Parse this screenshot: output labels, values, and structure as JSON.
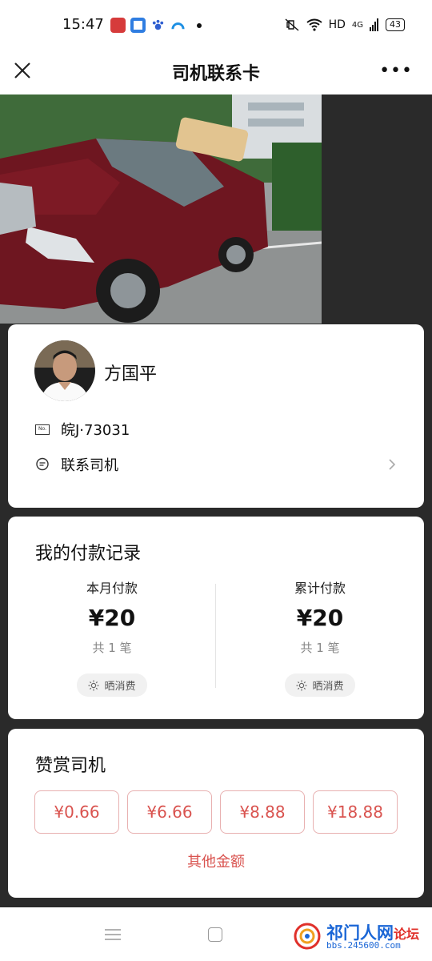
{
  "status_bar": {
    "time": "15:47",
    "network": "HD",
    "signal": "4G",
    "battery": "43",
    "app_icons": [
      "red-app-icon",
      "blue-circle-app-icon",
      "paw-app-icon",
      "arc-app-icon"
    ],
    "indicators": [
      "mute-icon",
      "wifi-icon",
      "signal-icon"
    ]
  },
  "nav": {
    "title": "司机联系卡",
    "close_icon": "close-icon",
    "more_icon": "more-icon",
    "more_label": "•••"
  },
  "driver": {
    "name": "方国平",
    "plate": "皖J·73031",
    "plate_icon_label": "No.",
    "contact_label": "联系司机"
  },
  "payments": {
    "title": "我的付款记录",
    "month": {
      "label": "本月付款",
      "amount": "¥20",
      "count": "共 1 笔",
      "share": "晒消费"
    },
    "total": {
      "label": "累计付款",
      "amount": "¥20",
      "count": "共 1 笔",
      "share": "晒消费"
    }
  },
  "tip": {
    "title": "赞赏司机",
    "options": [
      "¥0.66",
      "¥6.66",
      "¥8.88",
      "¥18.88"
    ],
    "other": "其他金额"
  },
  "watermark": {
    "title": "祁门人网",
    "accent": "论坛",
    "url": "bbs.245600.com"
  },
  "colors": {
    "accent": "#d9534f",
    "tip_border": "#e8b0b0",
    "page_bg": "#2a2a2a",
    "watermark_blue": "#1a66d6"
  }
}
